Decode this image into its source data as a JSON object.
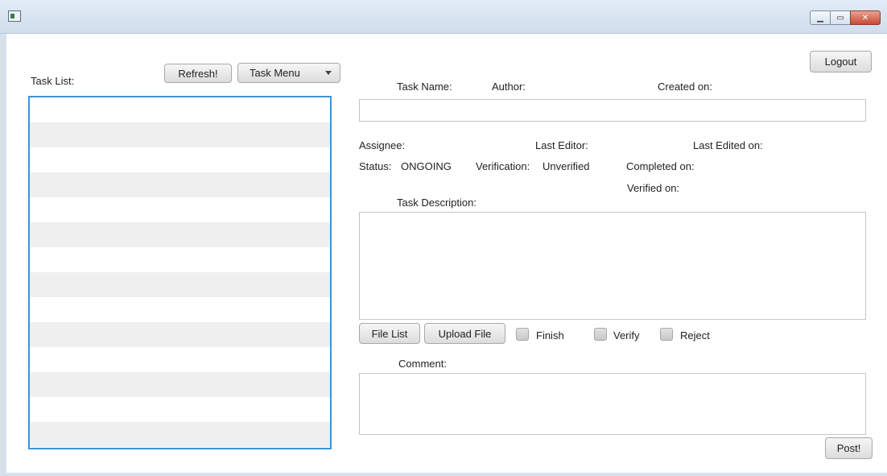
{
  "window": {
    "controls": [
      "minimize-icon",
      "maximize-icon",
      "close-icon"
    ]
  },
  "left": {
    "task_list_label": "Task List:",
    "refresh_label": "Refresh!",
    "task_menu_label": "Task Menu",
    "rows": [
      "",
      "",
      "",
      "",
      "",
      "",
      "",
      "",
      "",
      "",
      "",
      "",
      "",
      ""
    ]
  },
  "right": {
    "logout_label": "Logout",
    "task_name_label": "Task Name:",
    "author_label": "Author:",
    "created_on_label": "Created on:",
    "task_name_value": "",
    "assignee_label": "Assignee:",
    "last_editor_label": "Last Editor:",
    "last_edited_on_label": "Last Edited on:",
    "status_label": "Status:",
    "status_value": "ONGOING",
    "verification_label": "Verification:",
    "verification_value": "Unverified",
    "completed_on_label": "Completed on:",
    "verified_on_label": "Verified on:",
    "task_description_label": "Task Description:",
    "task_description_value": "",
    "file_list_label": "File List",
    "upload_file_label": "Upload File",
    "finish_label": "Finish",
    "verify_label": "Verify",
    "reject_label": "Reject",
    "comment_label": "Comment:",
    "comment_value": "",
    "post_label": "Post!"
  }
}
